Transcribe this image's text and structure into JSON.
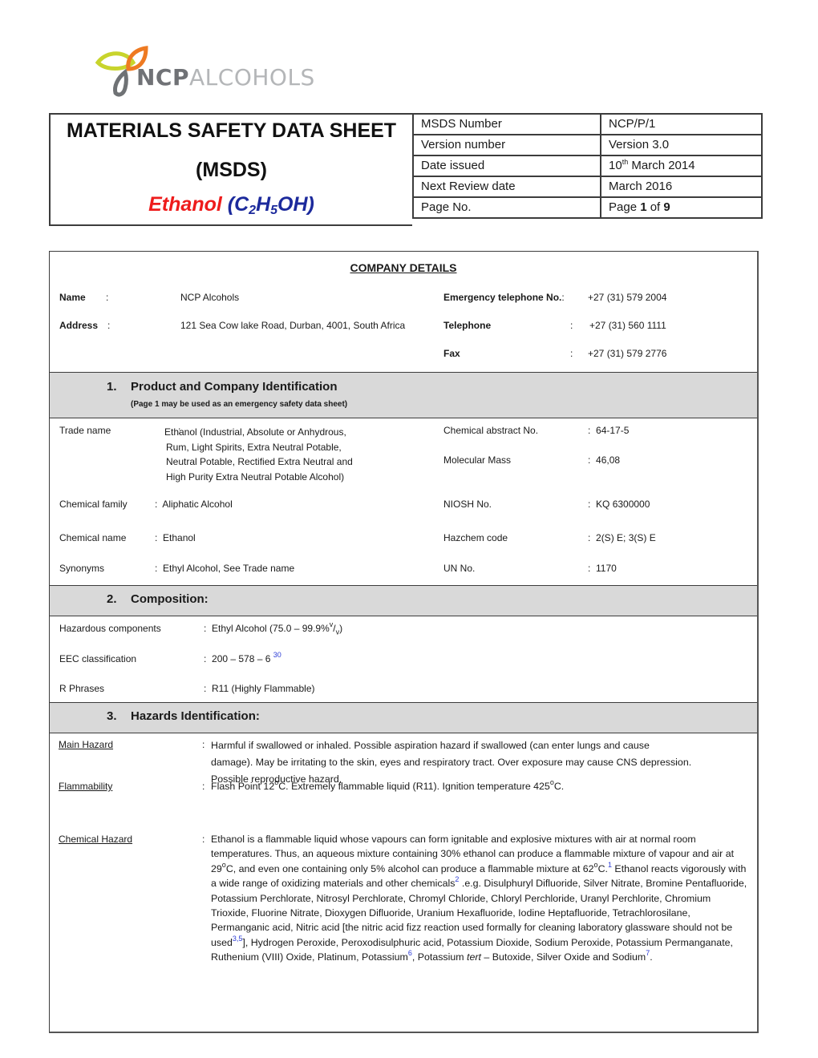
{
  "logo": {
    "brand_bold": "NCP",
    "brand_light": "ALCOHOLS",
    "colors": {
      "leaf_left": "#c8d42c",
      "leaf_right": "#ee7a22",
      "drop": "#6f7275"
    }
  },
  "header": {
    "title_line1": "MATERIALS SAFETY DATA SHEET",
    "title_line2": "(MSDS)",
    "product_name": "Ethanol",
    "formula_open": "(C",
    "formula_sub1": "2",
    "formula_mid": "H",
    "formula_sub2": "5",
    "formula_close": "OH)",
    "product_color": "#ee1c1c",
    "formula_color": "#1c2a9c",
    "meta": [
      {
        "label": "MSDS Number",
        "value": "NCP/P/1"
      },
      {
        "label": "Version number",
        "value": "Version 3.0"
      },
      {
        "label": "Date issued",
        "value_pre": "10",
        "value_sup": "th",
        "value_post": " March 2014"
      },
      {
        "label": "Next Review date",
        "value": "March 2016"
      },
      {
        "label": "Page No.",
        "value_pre": "Page ",
        "page": "1",
        "value_mid": " of ",
        "pages": "9"
      }
    ]
  },
  "company": {
    "title": "COMPANY DETAILS",
    "name_label": "Name",
    "name_value": "NCP Alcohols",
    "address_label": "Address",
    "address_value": "121 Sea Cow lake Road, Durban, 4001, South Africa",
    "emergency_label": "Emergency telephone No",
    "emergency_value": "+27 (31) 579 2004",
    "telephone_label": "Telephone",
    "telephone_value": "+27 (31) 560 1111",
    "fax_label": "Fax",
    "fax_value": "+27 (31) 579 2776",
    "colon": ":"
  },
  "section1": {
    "number": "1.",
    "title": "Product and Company Identification",
    "subtitle": "(Page 1 may be used as an emergency safety data sheet)",
    "left": [
      {
        "label": "Trade name",
        "value_lines": [
          "Ethanol (Industrial, Absolute or Anhydrous,",
          "Rum, Light Spirits, Extra Neutral Potable,",
          "Neutral Potable, Rectified Extra Neutral and",
          "High Purity Extra Neutral Potable Alcohol)"
        ]
      },
      {
        "label": "Chemical family",
        "value": "Aliphatic Alcohol"
      },
      {
        "label": "Chemical name",
        "value": "Ethanol"
      },
      {
        "label": "Synonyms",
        "value": "Ethyl Alcohol, See Trade name"
      }
    ],
    "right": [
      {
        "label": "Chemical abstract No.",
        "value": "64-17-5"
      },
      {
        "label": "Molecular Mass",
        "value": "46,08"
      },
      {
        "label": "NIOSH No.",
        "value": "KQ 6300000"
      },
      {
        "label": "Hazchem code",
        "value": "2(S) E; 3(S) E"
      },
      {
        "label": "UN No.",
        "value": "1170"
      }
    ]
  },
  "section2": {
    "number": "2.",
    "title": "Composition:",
    "rows": [
      {
        "label": "Hazardous components",
        "value_pre": "Ethyl Alcohol (75.0 – 99.9%",
        "sup": "v",
        "slash": "/",
        "sub": "v",
        "value_post": ")"
      },
      {
        "label": "EEC classification",
        "value": "200 – 578 – 6 ",
        "footnote": "30"
      },
      {
        "label": "R Phrases",
        "value": "R11 (Highly Flammable)"
      }
    ]
  },
  "section3": {
    "number": "3.",
    "title": "Hazards Identification:",
    "main_hazard": {
      "label": "Main Hazard",
      "lines": [
        "Harmful if swallowed or inhaled. Possible aspiration hazard if swallowed (can enter lungs and cause",
        "damage). May be irritating to the skin, eyes and respiratory tract. Over exposure may cause CNS depression.",
        "Possible reproductive hazard."
      ]
    },
    "flammability": {
      "label": "Flammability",
      "text_a": "Flash Point 12",
      "deg": "o",
      "text_b": "C. Extremely flammable liquid (R11). Ignition temperature 425",
      "text_c": "C."
    },
    "chemical_hazard": {
      "label": "Chemical Hazard",
      "p1": "Ethanol is a flammable liquid whose vapours can form ignitable and explosive mixtures with air at normal room temperatures. Thus, an aqueous mixture containing 30% ethanol can produce a flammable mixture of vapour and air at 29",
      "p2": "C, and even one containing only 5% alcohol can produce a flammable mixture at 62",
      "p3": "C.",
      "fn1": "1",
      "p4": " Ethanol reacts vigorously with a wide range of oxidizing materials and other chemicals",
      "fn2": "2",
      "p5": " .e.g. Disulphuryl Difluoride, Silver Nitrate, Bromine Pentafluoride, Potassium Perchlorate, Nitrosyl Perchlorate, Chromyl Chloride, Chloryl Perchloride, Uranyl Perchlorite, Chromium Trioxide, Fluorine Nitrate, Dioxygen Difluoride, Uranium Hexafluoride, Iodine Heptafluoride, Tetrachlorosilane, Permanganic acid, Nitric acid [the nitric acid fizz reaction used formally for cleaning laboratory glassware should not be used",
      "fn3": "3,5",
      "p6": "], Hydrogen Peroxide, Peroxodisulphuric acid, Potassium Dioxide, Sodium Peroxide, Potassium Permanganate, Ruthenium (VIII) Oxide, Platinum, Potassium",
      "fn4": "6",
      "p7": ", Potassium ",
      "p7i": "tert",
      "p8": " – Butoxide, Silver Oxide and Sodium",
      "fn5": "7",
      "p9": "."
    }
  }
}
